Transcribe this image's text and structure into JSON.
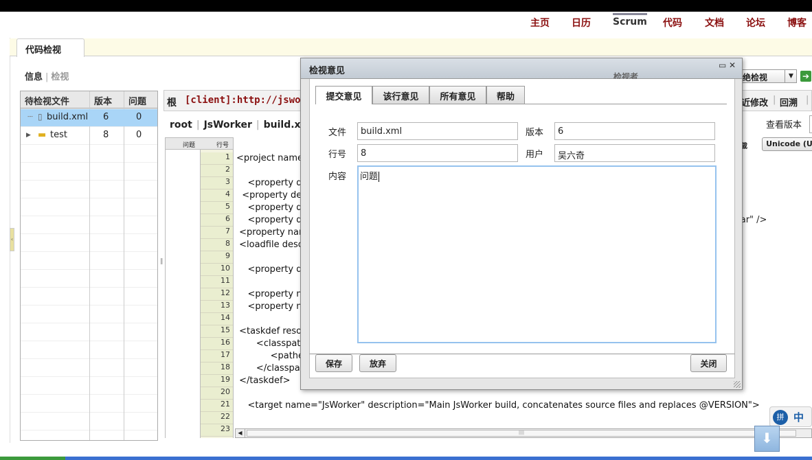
{
  "nav": {
    "items": [
      "主页",
      "日历",
      "Scrum",
      "代码",
      "文档",
      "论坛",
      "博客"
    ]
  },
  "main_tab": "代码检视",
  "subnav": {
    "info": "信息",
    "review": "检视"
  },
  "file_table": {
    "headers": [
      "待检视文件",
      "版本",
      "问题"
    ],
    "rows": [
      {
        "name": "build.xml",
        "version": "6",
        "issues": "0"
      },
      {
        "name": "test",
        "version": "8",
        "issues": "0"
      }
    ]
  },
  "path_bar": {
    "label": "根",
    "path": "[client]:http://jsworker."
  },
  "breadcrumbs": [
    "root",
    "JsWorker",
    "build.xml"
  ],
  "gutter": {
    "issue_header": "问题",
    "line_header": "行号"
  },
  "code": {
    "line_numbers": [
      "1",
      "2",
      "3",
      "4",
      "5",
      "6",
      "7",
      "8",
      "9",
      "10",
      "11",
      "12",
      "13",
      "14",
      "15",
      "16",
      "17",
      "18",
      "19",
      "20",
      "21",
      "22",
      "23"
    ],
    "lines": [
      "<project name=",
      "",
      "    <property de",
      "  <property desc",
      "    <property de",
      "    <property de",
      " <property name",
      " <loadfile descri",
      "",
      "    <property de",
      "",
      "    <property na",
      "    <property na",
      "",
      " <taskdef resou",
      "       <classpath",
      "            <pathe",
      "       </classpat",
      " </taskdef>",
      "",
      "    <target name=\"JsWorker\" description=\"Main JsWorker build, concatenates source files and replaces @VERSION\">",
      "",
      ""
    ],
    "line6_tail": ".jar\" />"
  },
  "right_tools": {
    "reviewer_label": "检视者",
    "reject_label": "拒绝检视",
    "recent_change": "最近修改",
    "rollback": "回溯",
    "view_version": "查看版本",
    "download": "下载",
    "encoding": "Unicode (U"
  },
  "dialog": {
    "title": "检视意见",
    "tabs": [
      "提交意见",
      "该行意见",
      "所有意见",
      "帮助"
    ],
    "fields": {
      "file_label": "文件",
      "file_value": "build.xml",
      "version_label": "版本",
      "version_value": "6",
      "line_label": "行号",
      "line_value": "8",
      "user_label": "用户",
      "user_value": "吴六奇",
      "content_label": "内容",
      "content_value": "问题"
    },
    "buttons": {
      "save": "保存",
      "discard": "放弃",
      "close": "关闭"
    }
  },
  "ime": {
    "label": "中"
  },
  "colors": {
    "nav_text": "#8b1010",
    "selected_row": "#a9d5f7",
    "textarea_border": "#95c2ee"
  }
}
